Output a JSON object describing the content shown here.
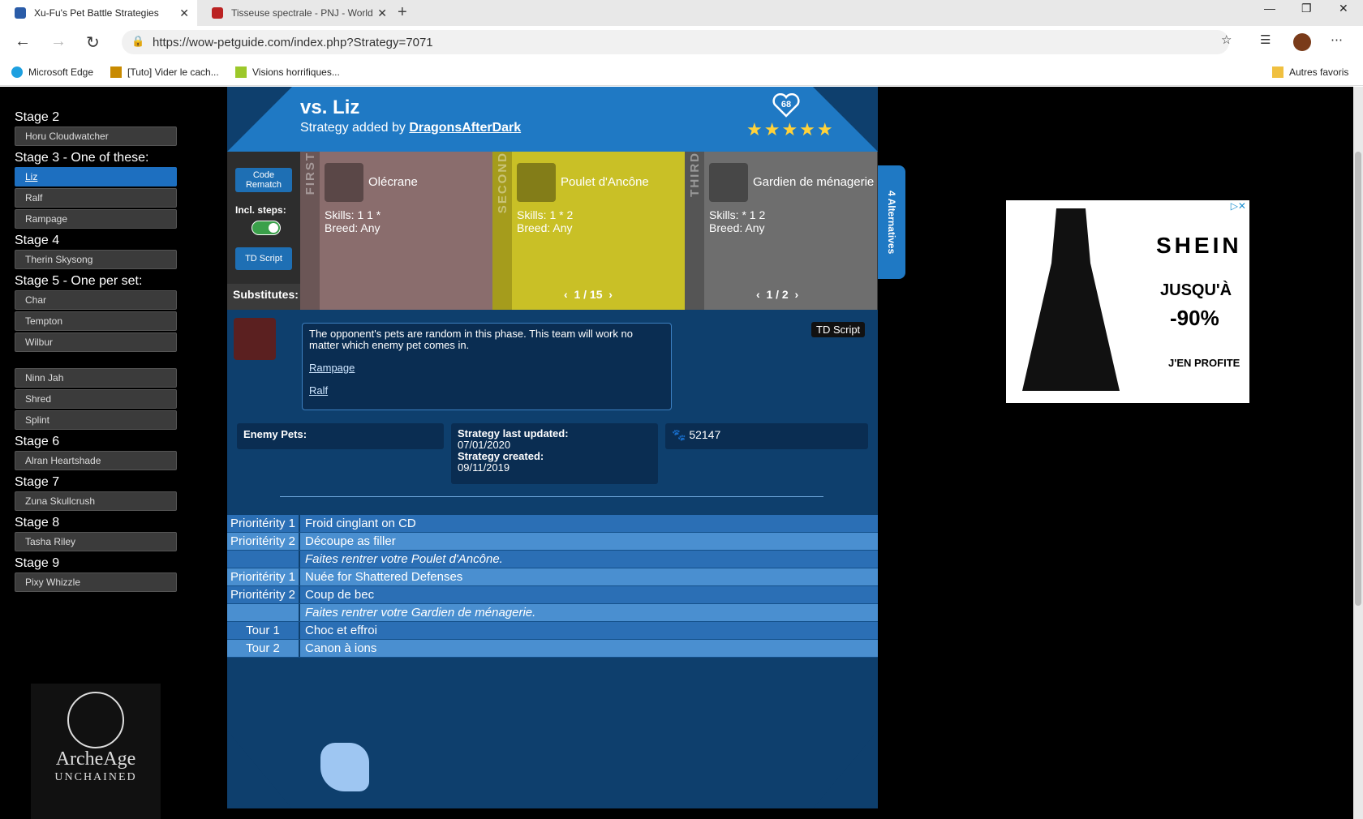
{
  "browser": {
    "tabs": [
      {
        "title": "Xu-Fu's Pet Battle Strategies"
      },
      {
        "title": "Tisseuse spectrale - PNJ - World"
      }
    ],
    "url": "https://wow-petguide.com/index.php?Strategy=7071",
    "bookmarks": [
      "Microsoft Edge",
      "[Tuto] Vider le cach...",
      "Visions horrifiques..."
    ],
    "other_favorites": "Autres favoris"
  },
  "sidebar": {
    "groups": [
      {
        "title": "Stage 2",
        "items": [
          "Horu Cloudwatcher"
        ]
      },
      {
        "title": "Stage 3 - One of these:",
        "items": [
          "Liz",
          "Ralf",
          "Rampage"
        ]
      },
      {
        "title": "Stage 4",
        "items": [
          "Therin Skysong"
        ]
      },
      {
        "title": "Stage 5 - One per set:",
        "items": [
          "Char",
          "Tempton",
          "Wilbur"
        ]
      },
      {
        "title": "",
        "items": [
          "Ninn Jah",
          "Shred",
          "Splint"
        ]
      },
      {
        "title": "Stage 6",
        "items": [
          "Alran Heartshade"
        ]
      },
      {
        "title": "Stage 7",
        "items": [
          "Zuna Skullcrush"
        ]
      },
      {
        "title": "Stage 8",
        "items": [
          "Tasha Riley"
        ]
      },
      {
        "title": "Stage 9",
        "items": [
          "Pixy Whizzle"
        ]
      }
    ],
    "selected": "Liz"
  },
  "strategy": {
    "title": "vs. Liz",
    "added_by_prefix": "Strategy added by",
    "author": "DragonsAfterDark",
    "likes": "68",
    "rating": 5,
    "code_rematch": "Code Rematch",
    "incl_steps": "Incl. steps:",
    "td_script": "TD Script",
    "substitutes": "Substitutes:",
    "alternatives": "4 Alternatives",
    "pets": [
      {
        "slot": "FIRST",
        "name": "Olécrane",
        "skills": "Skills: 1 1 *",
        "breed": "Breed: Any",
        "color": "#8a6d6d",
        "pager": ""
      },
      {
        "slot": "SECOND",
        "name": "Poulet d'Ancône",
        "skills": "Skills: 1 * 2",
        "breed": "Breed: Any",
        "color": "#c9c026",
        "pager": "1 / 15"
      },
      {
        "slot": "THIRD",
        "name": "Gardien de ménagerie",
        "skills": "Skills: * 1 2",
        "breed": "Breed: Any",
        "color": "#6e6e6e",
        "pager": "1 / 2"
      }
    ],
    "note": "The opponent's pets are random in this phase. This team will work no matter which enemy pet comes in.",
    "links": [
      "Rampage",
      "Ralf"
    ],
    "td_tag": "TD Script",
    "enemy_pets_label": "Enemy Pets:",
    "updated_label": "Strategy last updated:",
    "updated": "07/01/2020",
    "created_label": "Strategy created:",
    "created": "09/11/2019",
    "views": "52147",
    "steps": [
      {
        "turn": "Prioritérity 1",
        "action": "Froid cinglant on CD",
        "style": "odd"
      },
      {
        "turn": "Prioritérity 2",
        "action": "Découpe as filler",
        "style": "even"
      },
      {
        "turn": "",
        "action": "Faites rentrer votre Poulet d'Ancône.",
        "style": "odd italic"
      },
      {
        "turn": "Prioritérity 1",
        "action": "Nuée for Shattered Defenses",
        "style": "even"
      },
      {
        "turn": "Prioritérity 2",
        "action": "Coup de bec",
        "style": "odd"
      },
      {
        "turn": "",
        "action": "Faites rentrer votre Gardien de ménagerie.",
        "style": "even italic"
      },
      {
        "turn": "Tour 1",
        "action": "Choc et effroi",
        "style": "odd"
      },
      {
        "turn": "Tour 2",
        "action": "Canon à ions",
        "style": "even"
      }
    ]
  },
  "ads": {
    "right": {
      "brand": "SHEIN",
      "line1": "JUSQU'À",
      "line2": "-90%",
      "cta": "J'EN PROFITE"
    },
    "left": {
      "brand": "ArcheAge",
      "sub": "UNCHAINED"
    }
  }
}
